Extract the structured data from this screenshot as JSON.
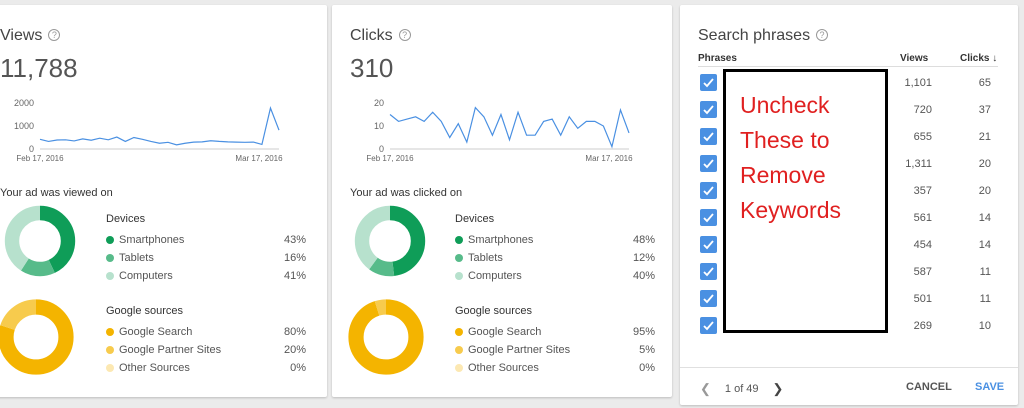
{
  "views": {
    "title": "Views",
    "value": "11,788",
    "chart_data": {
      "type": "line",
      "y_ticks": [
        "2000",
        "1000",
        "0"
      ],
      "ylim": [
        0,
        2000
      ],
      "x_labels": [
        "Feb 17, 2016",
        "Mar 17, 2016"
      ],
      "values": [
        420,
        330,
        390,
        400,
        350,
        440,
        380,
        470,
        400,
        520,
        330,
        500,
        420,
        330,
        250,
        290,
        180,
        250,
        300,
        310,
        360,
        330,
        310,
        300,
        290,
        300,
        200,
        1780,
        820
      ]
    },
    "section_label": "Your ad was viewed on",
    "devices": {
      "title": "Devices",
      "items": [
        {
          "label": "Smartphones",
          "pct": "43%",
          "value": 43,
          "color": "#0f9d58"
        },
        {
          "label": "Tablets",
          "pct": "16%",
          "value": 16,
          "color": "#57bb8a"
        },
        {
          "label": "Computers",
          "pct": "41%",
          "value": 41,
          "color": "#b7e1cd"
        }
      ]
    },
    "sources": {
      "title": "Google sources",
      "items": [
        {
          "label": "Google Search",
          "pct": "80%",
          "value": 80,
          "color": "#f4b400"
        },
        {
          "label": "Google Partner Sites",
          "pct": "20%",
          "value": 20,
          "color": "#f7cb4d"
        },
        {
          "label": "Other Sources",
          "pct": "0%",
          "value": 0,
          "color": "#fce8b2"
        }
      ]
    }
  },
  "clicks": {
    "title": "Clicks",
    "value": "310",
    "chart_data": {
      "type": "line",
      "y_ticks": [
        "20",
        "10",
        "0"
      ],
      "ylim": [
        0,
        20
      ],
      "x_labels": [
        "Feb 17, 2016",
        "Mar 17, 2016"
      ],
      "values": [
        15,
        12,
        13,
        14,
        12,
        16,
        12,
        5,
        11,
        3,
        18,
        14,
        6,
        15,
        4,
        16,
        6,
        6,
        12,
        13,
        6,
        14,
        9,
        12,
        12,
        10,
        1,
        17,
        7
      ]
    },
    "section_label": "Your ad was clicked on",
    "devices": {
      "title": "Devices",
      "items": [
        {
          "label": "Smartphones",
          "pct": "48%",
          "value": 48,
          "color": "#0f9d58"
        },
        {
          "label": "Tablets",
          "pct": "12%",
          "value": 12,
          "color": "#57bb8a"
        },
        {
          "label": "Computers",
          "pct": "40%",
          "value": 40,
          "color": "#b7e1cd"
        }
      ]
    },
    "sources": {
      "title": "Google sources",
      "items": [
        {
          "label": "Google Search",
          "pct": "95%",
          "value": 95,
          "color": "#f4b400"
        },
        {
          "label": "Google Partner Sites",
          "pct": "5%",
          "value": 5,
          "color": "#f7cb4d"
        },
        {
          "label": "Other Sources",
          "pct": "0%",
          "value": 0,
          "color": "#fce8b2"
        }
      ]
    }
  },
  "phrases": {
    "title": "Search phrases",
    "headers": {
      "phrases": "Phrases",
      "views": "Views",
      "clicks": "Clicks"
    },
    "rows": [
      {
        "views": "1,101",
        "clicks": "65"
      },
      {
        "views": "720",
        "clicks": "37"
      },
      {
        "views": "655",
        "clicks": "21"
      },
      {
        "views": "1,311",
        "clicks": "20"
      },
      {
        "views": "357",
        "clicks": "20"
      },
      {
        "views": "561",
        "clicks": "14"
      },
      {
        "views": "454",
        "clicks": "14"
      },
      {
        "views": "587",
        "clicks": "11"
      },
      {
        "views": "501",
        "clicks": "11"
      },
      {
        "views": "269",
        "clicks": "10"
      }
    ],
    "annotation": [
      "Uncheck",
      "These to",
      "Remove",
      "Keywords"
    ],
    "pager": "1 of 49",
    "cancel_label": "CANCEL",
    "save_label": "SAVE",
    "accent": "#4a90e2"
  }
}
